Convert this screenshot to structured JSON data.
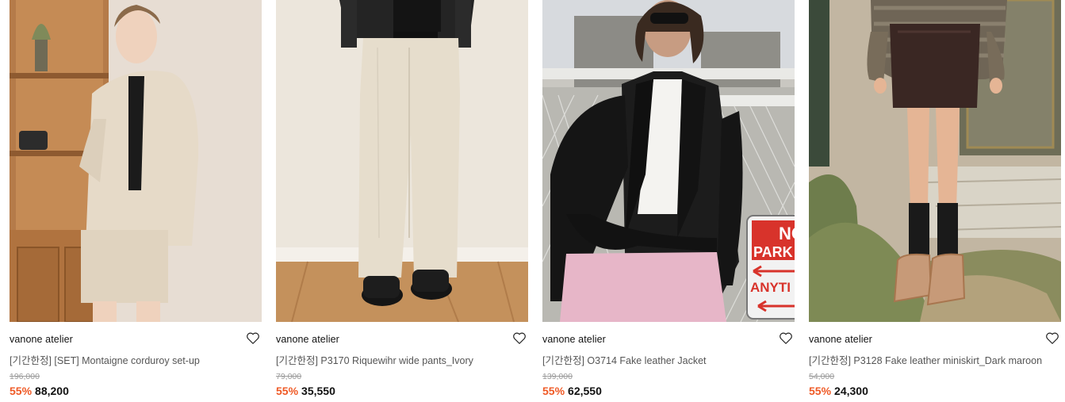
{
  "products": [
    {
      "brand": "vanone atelier",
      "name": "[기간한정] [SET] Montaigne corduroy set-up",
      "original_price": "196,000",
      "discount": "55%",
      "price": "88,200",
      "image_desc": "model in ivory corduroy blazer and shorts set beside wooden cabinet"
    },
    {
      "brand": "vanone atelier",
      "name": "[기간한정] P3170 Riquewihr wide pants_Ivory",
      "original_price": "79,000",
      "discount": "55%",
      "price": "35,550",
      "image_desc": "ivory wide-leg pants with black loafers on wooden floor"
    },
    {
      "brand": "vanone atelier",
      "name": "[기간한정] O3714 Fake leather Jacket",
      "original_price": "139,000",
      "discount": "55%",
      "price": "62,550",
      "image_desc": "model in black leather biker jacket and pink skirt by chain-link fence"
    },
    {
      "brand": "vanone atelier",
      "name": "[기간한정] P3128 Fake leather miniskirt_Dark maroon",
      "original_price": "54,000",
      "discount": "55%",
      "price": "24,300",
      "image_desc": "dark maroon leather mini skirt with knee socks and sneakers outdoors"
    }
  ],
  "sign_text": [
    "NO",
    "PARK",
    "ANYTI"
  ],
  "colors": {
    "discount": "#ef5a26",
    "original_price": "#9a9a9a",
    "name": "#555555"
  },
  "icons": {
    "wishlist": "heart-outline-icon"
  }
}
